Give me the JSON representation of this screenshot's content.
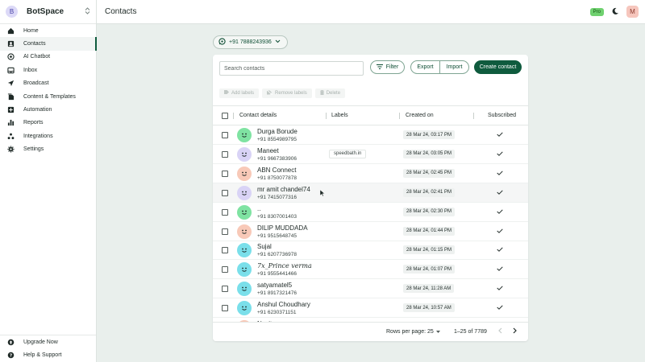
{
  "brand": {
    "initial": "B",
    "name": "BotSpace"
  },
  "nav": [
    {
      "label": "Home",
      "icon": "home-icon"
    },
    {
      "label": "Contacts",
      "icon": "contacts-icon",
      "active": true
    },
    {
      "label": "AI Chatbot",
      "icon": "chatbot-icon"
    },
    {
      "label": "Inbox",
      "icon": "inbox-icon"
    },
    {
      "label": "Broadcast",
      "icon": "broadcast-icon"
    },
    {
      "label": "Content & Templates",
      "icon": "templates-icon"
    },
    {
      "label": "Automation",
      "icon": "automation-icon"
    },
    {
      "label": "Reports",
      "icon": "reports-icon"
    },
    {
      "label": "Integrations",
      "icon": "integrations-icon"
    },
    {
      "label": "Settings",
      "icon": "gear-icon"
    }
  ],
  "nav_bottom": [
    {
      "label": "Upgrade Now",
      "icon": "upgrade-icon"
    },
    {
      "label": "Help & Support",
      "icon": "help-icon"
    }
  ],
  "header": {
    "title": "Contacts",
    "plan_badge": "Pro",
    "user_initial": "M"
  },
  "number_selector": {
    "value": "+91 7888243936"
  },
  "toolbar": {
    "search_placeholder": "Search contacts",
    "filter_label": "Filter",
    "export_label": "Export",
    "import_label": "Import",
    "create_label": "Create contact"
  },
  "bulk_actions": {
    "add_labels": "Add labels",
    "remove_labels": "Remove labels",
    "delete": "Delete"
  },
  "table": {
    "columns": {
      "contact": "Contact details",
      "labels": "Labels",
      "created": "Created on",
      "subscribed": "Subscribed"
    },
    "rows": [
      {
        "name": "Durga Borude",
        "phone": "+91 8554989795",
        "label": "",
        "created": "28 Mar 24, 03:17 PM",
        "subscribed": true,
        "avatar_color": "#7fe3a2"
      },
      {
        "name": "Maneet",
        "phone": "+91 9667383906",
        "label": "speedbath.in",
        "created": "28 Mar 24, 03:05 PM",
        "subscribed": true,
        "avatar_color": "#d9d3f6"
      },
      {
        "name": "ABN Connect",
        "phone": "+91 8750077878",
        "label": "",
        "created": "28 Mar 24, 02:45 PM",
        "subscribed": true,
        "avatar_color": "#f8c9b8"
      },
      {
        "name": "mr amit chandel74",
        "phone": "+91 7415077316",
        "label": "",
        "created": "28 Mar 24, 02:41 PM",
        "subscribed": true,
        "avatar_color": "#d9d3f6",
        "hover": true
      },
      {
        "name": "..",
        "phone": "+91 8307001403",
        "label": "",
        "created": "28 Mar 24, 02:30 PM",
        "subscribed": true,
        "avatar_color": "#7fe3a2"
      },
      {
        "name": "DILIP MUDDADA",
        "phone": "+91 9515648745",
        "label": "",
        "created": "28 Mar 24, 01:44 PM",
        "subscribed": true,
        "avatar_color": "#f8c9b8"
      },
      {
        "name": "Sujal",
        "phone": "+91 6207736978",
        "label": "",
        "created": "28 Mar 24, 01:15 PM",
        "subscribed": true,
        "avatar_color": "#7adfea"
      },
      {
        "name": "7x_Prince verma",
        "phone": "+91 9555441466",
        "label": "",
        "created": "28 Mar 24, 01:07 PM",
        "subscribed": true,
        "avatar_color": "#7adfea",
        "script": true
      },
      {
        "name": "satyamatel5",
        "phone": "+91 8917321476",
        "label": "",
        "created": "28 Mar 24, 11:28 AM",
        "subscribed": true,
        "avatar_color": "#7adfea"
      },
      {
        "name": "Anshul Choudhary",
        "phone": "+91 6230371151",
        "label": "",
        "created": "28 Mar 24, 10:57 AM",
        "subscribed": true,
        "avatar_color": "#7adfea"
      },
      {
        "name": "Navita",
        "phone": "",
        "label": "",
        "created": "",
        "subscribed": false,
        "avatar_color": "#f8c9b8"
      }
    ]
  },
  "pagination": {
    "rows_per_page_label": "Rows per page:",
    "rows_per_page": "25",
    "range": "1–25 of 7789"
  },
  "colors": {
    "brand_green": "#0f5b3e",
    "background": "#e9efec",
    "pro_badge": "#6fd16f"
  }
}
